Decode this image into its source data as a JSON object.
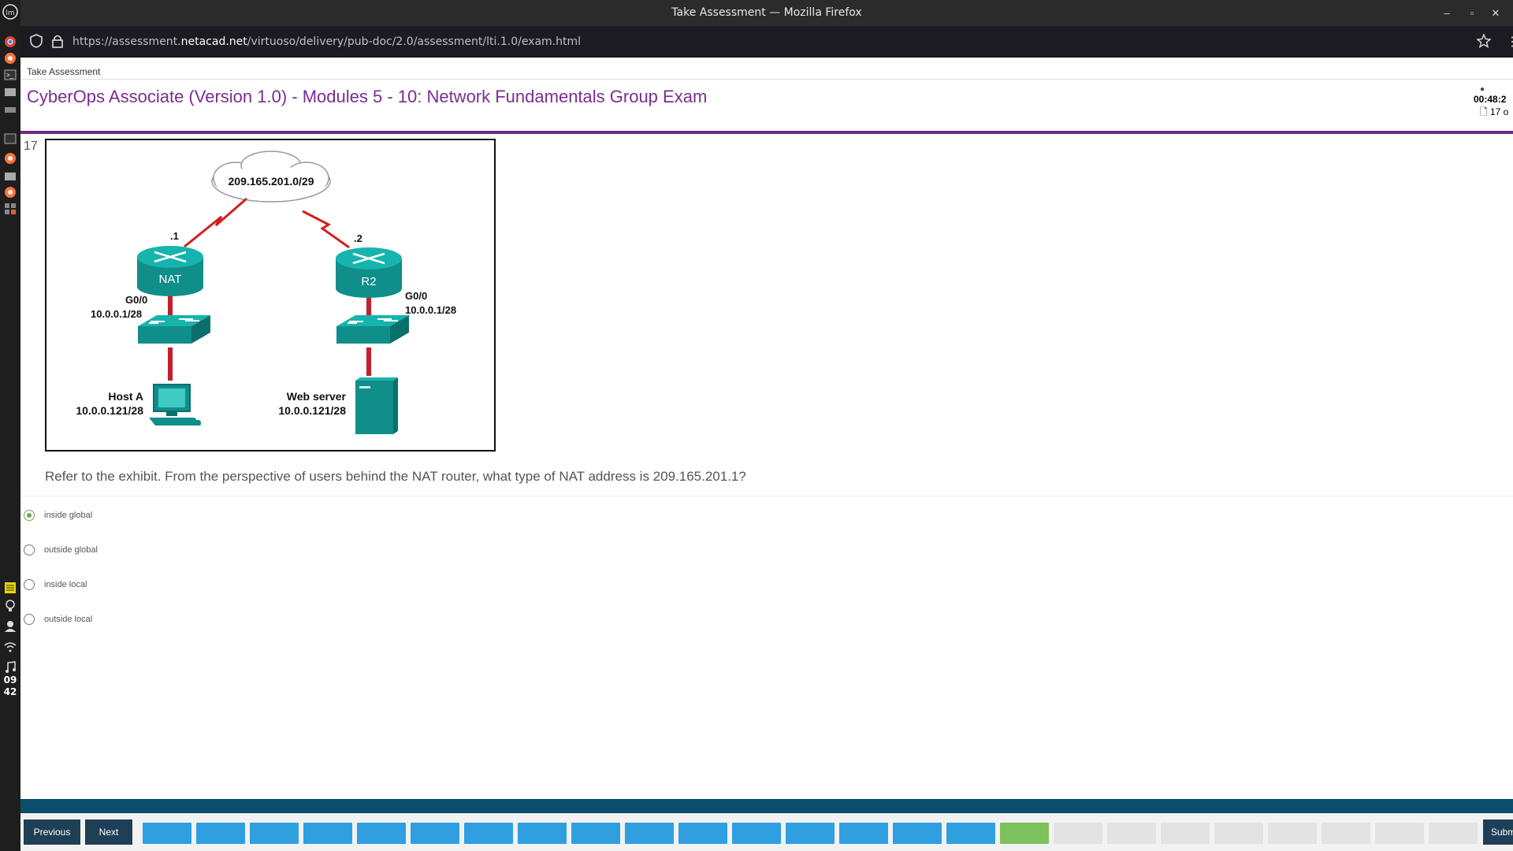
{
  "window": {
    "title": "Take Assessment — Mozilla Firefox"
  },
  "browser": {
    "url_prefix": "https://assessment.",
    "url_domain": "netacad.net",
    "url_suffix": "/virtuoso/delivery/pub-doc/2.0/assessment/lti.1.0/exam.html"
  },
  "dock": {
    "time_hour": "09",
    "time_min": "42"
  },
  "page": {
    "breadcrumb": "Take Assessment",
    "exam_title": "CyberOps Associate (Version 1.0) - Modules 5 - 10: Network Fundamentals Group Exam",
    "timer": "00:48:2",
    "question_count": "17 o"
  },
  "question": {
    "number": "17",
    "text": "Refer to the exhibit. From the perspective of users behind the NAT router, what type of NAT address is 209.165.201.1?",
    "options": [
      {
        "label": "inside global",
        "selected": true
      },
      {
        "label": "outside global",
        "selected": false
      },
      {
        "label": "inside local",
        "selected": false
      },
      {
        "label": "outside local",
        "selected": false
      }
    ]
  },
  "exhibit": {
    "cloud_label": "209.165.201.0/29",
    "nat_link_label": ".1",
    "r2_link_label": ".2",
    "nat_router_label": "NAT",
    "r2_router_label": "R2",
    "nat_if_name": "G0/0",
    "nat_if_ip": "10.0.0.1/28",
    "r2_if_name": "G0/0",
    "r2_if_ip": "10.0.0.1/28",
    "host_name": "Host A",
    "host_ip": "10.0.0.121/28",
    "server_name": "Web server",
    "server_ip": "10.0.0.121/28"
  },
  "nav": {
    "previous": "Previous",
    "next": "Next",
    "submit": "Subm",
    "answered_color": "#2f9fe0",
    "current_color": "#7dc25c",
    "unanswered_color": "#e3e3e3",
    "boxes": [
      "answered",
      "answered",
      "answered",
      "answered",
      "answered",
      "answered",
      "answered",
      "answered",
      "answered",
      "answered",
      "answered",
      "answered",
      "answered",
      "answered",
      "answered",
      "answered",
      "current",
      "unanswered",
      "unanswered",
      "unanswered",
      "unanswered",
      "unanswered",
      "unanswered",
      "unanswered",
      "unanswered"
    ]
  }
}
